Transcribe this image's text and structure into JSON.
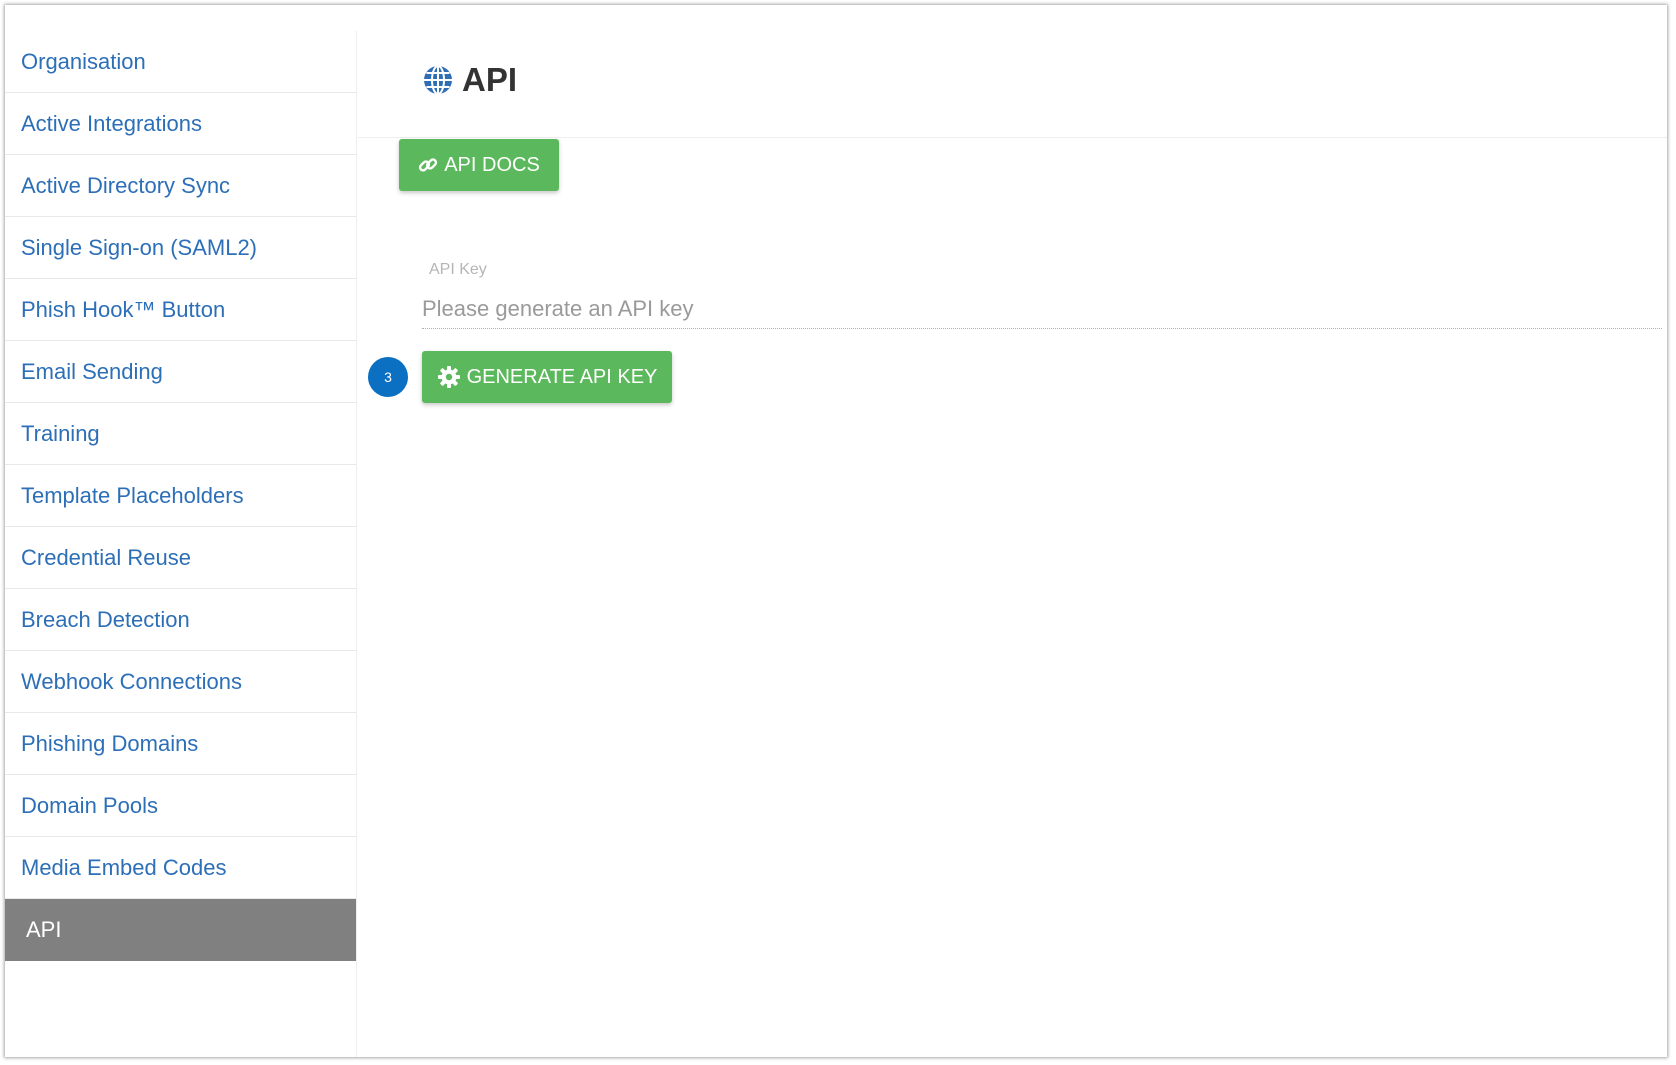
{
  "sidebar": {
    "items": [
      {
        "label": "Organisation"
      },
      {
        "label": "Active Integrations"
      },
      {
        "label": "Active Directory Sync"
      },
      {
        "label": "Single Sign-on (SAML2)"
      },
      {
        "label": "Phish Hook™ Button"
      },
      {
        "label": "Email Sending"
      },
      {
        "label": "Training"
      },
      {
        "label": "Template Placeholders"
      },
      {
        "label": "Credential Reuse"
      },
      {
        "label": "Breach Detection"
      },
      {
        "label": "Webhook Connections"
      },
      {
        "label": "Phishing Domains"
      },
      {
        "label": "Domain Pools"
      },
      {
        "label": "Media Embed Codes"
      },
      {
        "label": "API",
        "active": true
      }
    ]
  },
  "main": {
    "title": "API",
    "title_icon": "globe-icon",
    "docs_button": {
      "label": "API DOCS",
      "icon": "link-icon"
    },
    "api_key": {
      "label": "API Key",
      "placeholder": "Please generate an API key",
      "value": ""
    },
    "generate_button": {
      "label": "GENERATE API KEY",
      "icon": "gear-icon"
    },
    "step_badge": "3"
  },
  "colors": {
    "link": "#2d6fb7",
    "active_bg": "#808080",
    "button_green": "#5cb85c",
    "badge_blue": "#0b6fc2",
    "globe_blue": "#2f6db5"
  }
}
